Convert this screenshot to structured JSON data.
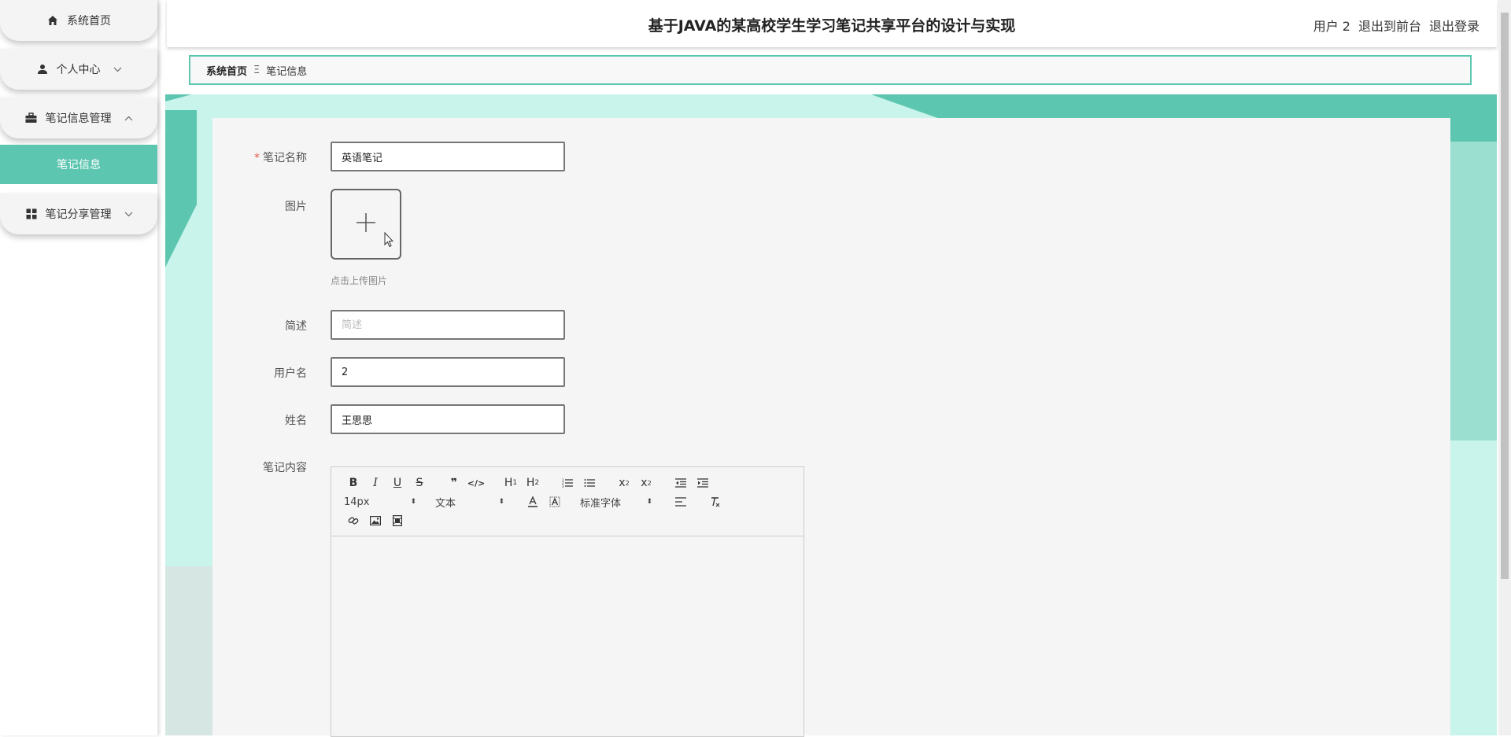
{
  "app": {
    "title": "基于JAVA的某高校学生学习笔记共享平台的设计与实现",
    "links": [
      "用户 2",
      "退出到前台",
      "退出登录"
    ]
  },
  "sidebar": {
    "items": [
      {
        "label": "系统首页",
        "icon": "home-icon"
      },
      {
        "label": "个人中心",
        "icon": "user-icon",
        "chevron": "down"
      },
      {
        "label": "笔记信息管理",
        "icon": "briefcase-icon",
        "chevron": "up"
      },
      {
        "label": "笔记分享管理",
        "icon": "grid-icon",
        "chevron": "down"
      }
    ],
    "active_sub": "笔记信息"
  },
  "breadcrumb": {
    "home": "系统首页",
    "separator": "Ξ",
    "current": "笔记信息"
  },
  "form": {
    "name_label": "笔记名称",
    "name_value": "英语笔记",
    "image_label": "图片",
    "image_hint": "点击上传图片",
    "desc_label": "简述",
    "desc_placeholder": "简述",
    "username_label": "用户名",
    "username_value": "2",
    "realname_label": "姓名",
    "realname_value": "王思思",
    "content_label": "笔记内容"
  },
  "editor": {
    "size": "14px",
    "header": "文本",
    "font": "标准字体"
  },
  "colors": {
    "accent": "#5dc6b0",
    "required": "#e25b4b"
  }
}
